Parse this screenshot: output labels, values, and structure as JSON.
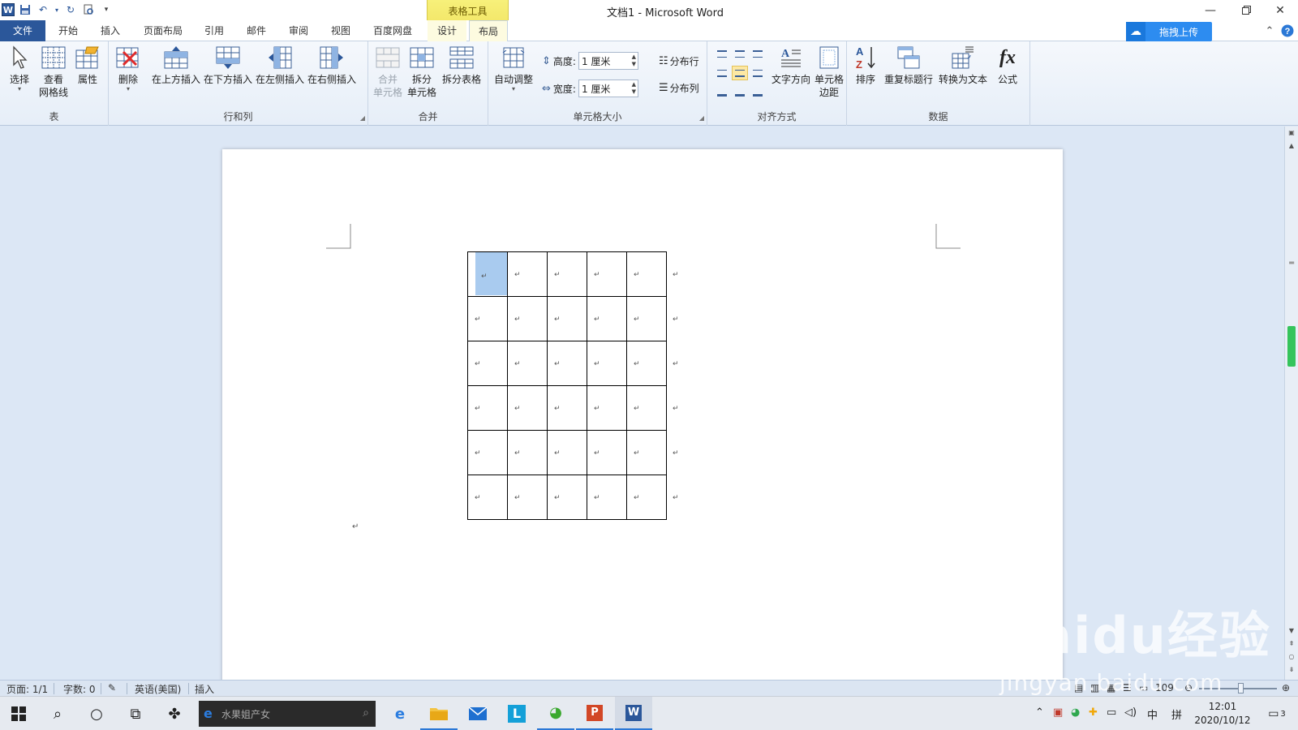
{
  "window": {
    "title": "文档1 - Microsoft Word",
    "context_title": "表格工具",
    "minimize_icon": "minimize-icon",
    "restore_icon": "restore-icon",
    "close_icon": "close-icon"
  },
  "qat": {
    "icons": [
      "word-logo-icon",
      "save-icon",
      "undo-icon",
      "redo-icon",
      "print-preview-icon",
      "customize-qat-icon"
    ],
    "word_logo": "W"
  },
  "tabs": [
    {
      "label": "文件"
    },
    {
      "label": "开始"
    },
    {
      "label": "插入"
    },
    {
      "label": "页面布局"
    },
    {
      "label": "引用"
    },
    {
      "label": "邮件"
    },
    {
      "label": "审阅"
    },
    {
      "label": "视图"
    },
    {
      "label": "百度网盘"
    },
    {
      "label": "设计"
    },
    {
      "label": "布局"
    }
  ],
  "active_tab": "布局",
  "upload_button": "拖拽上传",
  "ribbon": {
    "table_group": {
      "label": "表",
      "select": "选择",
      "gridlines_line1": "查看",
      "gridlines_line2": "网格线",
      "properties": "属性"
    },
    "rows_cols_group": {
      "label": "行和列",
      "delete": "删除",
      "insert_above": "在上方插入",
      "insert_below": "在下方插入",
      "insert_left": "在左侧插入",
      "insert_right": "在右侧插入"
    },
    "merge_group": {
      "label": "合并",
      "merge_line1": "合并",
      "merge_line2": "单元格",
      "split_cells_line1": "拆分",
      "split_cells_line2": "单元格",
      "split_table": "拆分表格"
    },
    "cell_size_group": {
      "label": "单元格大小",
      "autofit": "自动调整",
      "height_label": "高度:",
      "height_value": "1 厘米",
      "width_label": "宽度:",
      "width_value": "1 厘米",
      "distribute_rows": "分布行",
      "distribute_cols": "分布列"
    },
    "alignment_group": {
      "label": "对齐方式",
      "text_direction": "文字方向",
      "cell_margins_line1": "单元格",
      "cell_margins_line2": "边距"
    },
    "data_group": {
      "label": "数据",
      "sort": "排序",
      "repeat_header": "重复标题行",
      "convert_to_text": "转换为文本",
      "formula": "公式"
    }
  },
  "document": {
    "table_rows": 6,
    "table_cols": 5,
    "cell_mark": "↵",
    "paragraph_mark": "↵"
  },
  "statusbar": {
    "page": "页面: 1/1",
    "words": "字数: 0",
    "language": "英语(美国)",
    "mode": "插入",
    "zoom": "109"
  },
  "taskbar": {
    "search_placeholder": "水果姐产女",
    "apps": [
      "start-icon",
      "search-icon",
      "cortana-icon",
      "task-view-icon",
      "pinwheel-app-icon",
      "edge-icon",
      "file-explorer-icon",
      "mail-icon",
      "l-app-icon",
      "browser-icon",
      "powerpoint-icon",
      "word-icon"
    ],
    "tray_ime_lang": "中",
    "tray_ime_mode": "拼",
    "time": "12:01",
    "date": "2020/10/12",
    "notification_count": "3"
  },
  "watermark": {
    "brand": "Baidu经验",
    "url": "jingyan.baidu.com"
  },
  "colors": {
    "accent": "#2b579a",
    "context_tab": "#f3e86b",
    "selected_cell": "#a9cbef",
    "doc_bg": "#dce7f5"
  }
}
